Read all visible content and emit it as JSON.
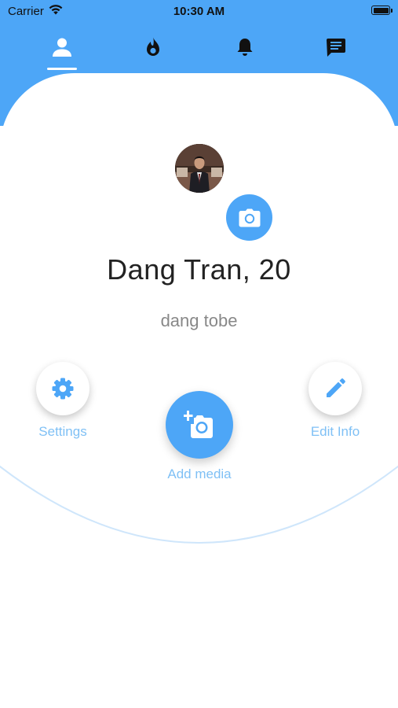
{
  "status_bar": {
    "carrier": "Carrier",
    "time": "10:30 AM"
  },
  "tabs": [
    {
      "name": "profile",
      "icon": "person-icon",
      "active": true
    },
    {
      "name": "discover",
      "icon": "flame-icon",
      "active": false
    },
    {
      "name": "notifications",
      "icon": "bell-icon",
      "active": false
    },
    {
      "name": "messages",
      "icon": "chat-icon",
      "active": false
    }
  ],
  "profile": {
    "name": "Dang Tran, 20",
    "bio": "dang tobe"
  },
  "actions": {
    "settings_label": "Settings",
    "add_media_label": "Add media",
    "edit_info_label": "Edit Info"
  },
  "colors": {
    "accent": "#4da6f7",
    "label": "#7fc0f5",
    "name_text": "#222222",
    "bio_text": "#888888"
  }
}
